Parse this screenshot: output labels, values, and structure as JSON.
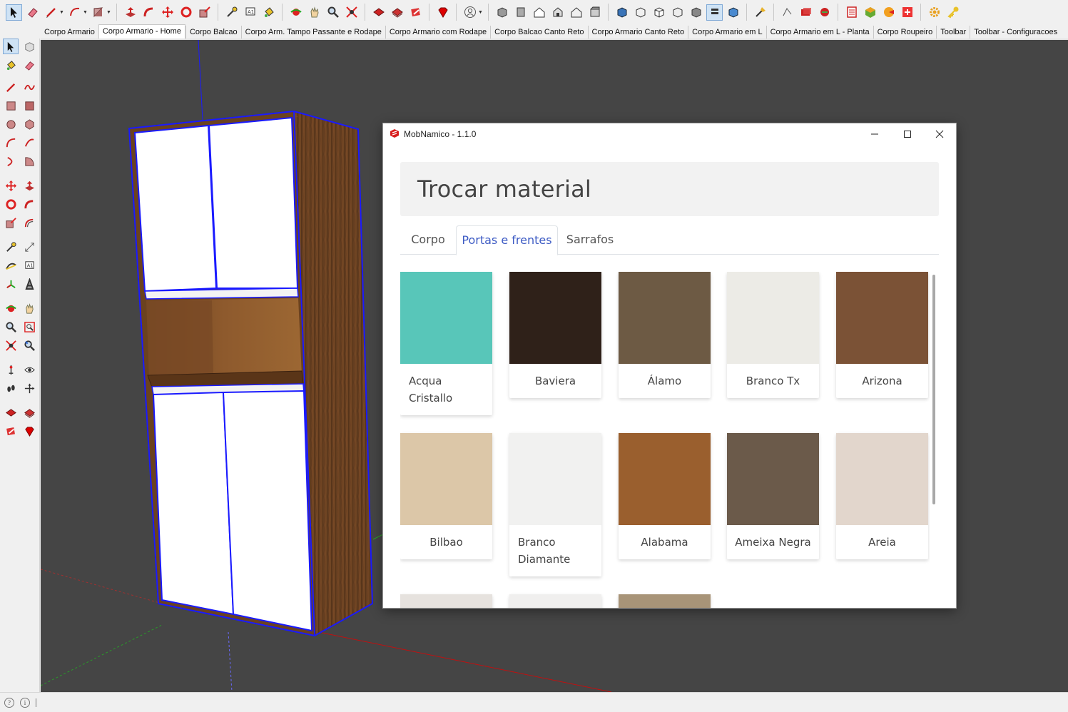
{
  "app": {
    "scene_tabs": [
      {
        "label": "Corpo Armario",
        "active": false
      },
      {
        "label": "Corpo Armario - Home",
        "active": true
      },
      {
        "label": "Corpo Balcao",
        "active": false
      },
      {
        "label": "Corpo Arm. Tampo Passante e Rodape",
        "active": false
      },
      {
        "label": "Corpo Armario com Rodape",
        "active": false
      },
      {
        "label": "Corpo Balcao Canto Reto",
        "active": false
      },
      {
        "label": "Corpo Armario Canto Reto",
        "active": false
      },
      {
        "label": "Corpo Armario em L",
        "active": false
      },
      {
        "label": "Corpo Armario em L - Planta",
        "active": false
      },
      {
        "label": "Corpo Roupeiro",
        "active": false
      },
      {
        "label": "Toolbar",
        "active": false
      },
      {
        "label": "Toolbar - Configuracoes",
        "active": false
      }
    ],
    "colors": {
      "viewport_bg": "#454545",
      "selection_blue": "#1a1aff",
      "wood": "#7a4a26",
      "accent_tab": "#3d5bc4"
    }
  },
  "dialog": {
    "window_title": "MobNamico - 1.1.0",
    "heading": "Trocar material",
    "tabs": [
      {
        "label": "Corpo",
        "active": false
      },
      {
        "label": "Portas e frentes",
        "active": true
      },
      {
        "label": "Sarrafos",
        "active": false
      }
    ],
    "materials": [
      {
        "name": "Acqua Cristallo",
        "color": "#58c6b9"
      },
      {
        "name": "Baviera",
        "color": "#2f2119"
      },
      {
        "name": "Álamo",
        "color": "#6d5a44"
      },
      {
        "name": "Branco Tx",
        "color": "#ecebe6"
      },
      {
        "name": "Arizona",
        "color": "#7b5236"
      },
      {
        "name": "Bilbao",
        "color": "#dcc7a8"
      },
      {
        "name": "Branco Diamante",
        "color": "#f1f1f0"
      },
      {
        "name": "Alabama",
        "color": "#9a5f2e"
      },
      {
        "name": "Ameixa Negra",
        "color": "#6b5a4a"
      },
      {
        "name": "Areia",
        "color": "#e2d6cc"
      },
      {
        "name": "",
        "color": "#e6e2de"
      },
      {
        "name": "",
        "color": "#f0efee"
      },
      {
        "name": "",
        "color": "#a89478"
      }
    ]
  }
}
